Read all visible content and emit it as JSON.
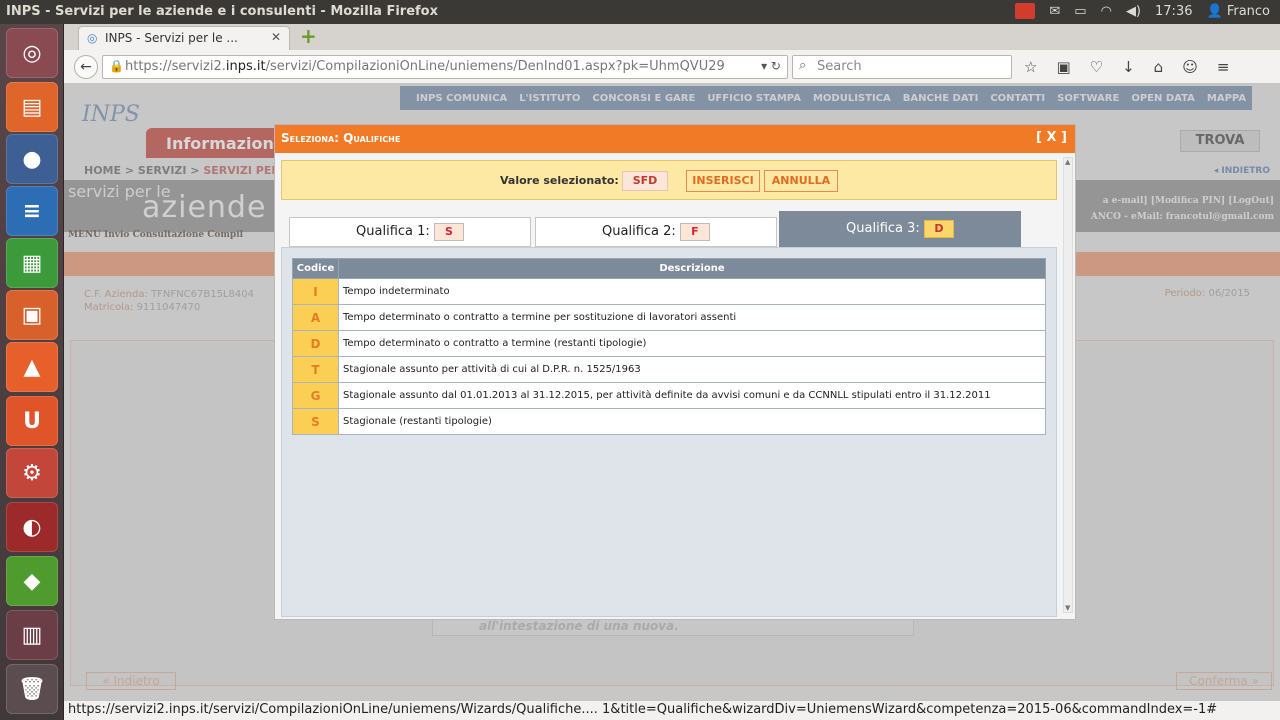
{
  "os": {
    "window_title": "INPS - Servizi per le aziende e i consulenti - Mozilla Firefox",
    "time": "17:36",
    "user": "Franco"
  },
  "browser": {
    "tab_title": "INPS - Servizi per le ...",
    "url_prefix": "https://servizi2.",
    "url_domain": "inps.it",
    "url_path": "/servizi/CompilazioniOnLine/uniemens/DenInd01.aspx?pk=UhmQVU29",
    "search_placeholder": "Search",
    "status_url": "https://servizi2.inps.it/servizi/CompilazioniOnLine/uniemens/Wizards/Qualifiche.... 1&title=Qualifiche&wizardDiv=UniemensWizard&competenza=2015-06&commandIndex=-1#"
  },
  "site": {
    "logo": "INPS",
    "top_menu": [
      "INPS COMUNICA",
      "L'ISTITUTO",
      "CONCORSI E GARE",
      "UFFICIO STAMPA",
      "MODULISTICA",
      "BANCHE DATI",
      "CONTATTI",
      "SOFTWARE",
      "OPEN DATA",
      "MAPPA"
    ],
    "info_tab": "Informazion",
    "trova": "TROVA",
    "breadcrumb_home": "HOME > SERVIZI > ",
    "breadcrumb_current": "SERVIZI PER L",
    "indietro_top": "INDIETRO",
    "az_small": "servizi per le",
    "az_big": "aziende",
    "az_links": "a e-mail]  [Modifica PIN]  [LogOut]",
    "az_links2": "ANCO - eMail: francotul@gmail.com",
    "menu_line": "MENU  Invio  Consultazione  Compil",
    "cf_label": "C.F. Azienda:",
    "cf_value": "TFNFNC67B15L8404",
    "matricola_label": "Matricola:",
    "matricola_value": "9111047470",
    "periodo_label": "Periodo:",
    "periodo_value": "06/2015",
    "intestazione": "all'intestazione di una nuova.",
    "btn_indietro": "« Indietro",
    "btn_conferma": "Conferma »"
  },
  "dialog": {
    "title": "Seleziona: Qualifiche",
    "close": "[ X ]",
    "selected_label": "Valore selezionato:",
    "selected_value": "SFD",
    "insert": "INSERISCI",
    "cancel": "ANNULLA",
    "tabs": [
      {
        "label": "Qualifica 1:",
        "value": "S"
      },
      {
        "label": "Qualifica 2:",
        "value": "F"
      },
      {
        "label": "Qualifica 3:",
        "value": "D"
      }
    ],
    "table": {
      "col_code": "Codice",
      "col_desc": "Descrizione",
      "rows": [
        {
          "code": "I",
          "desc": "Tempo indeterminato"
        },
        {
          "code": "A",
          "desc": "Tempo determinato o contratto a termine per sostituzione di lavoratori assenti"
        },
        {
          "code": "D",
          "desc": "Tempo determinato o contratto a termine (restanti tipologie)"
        },
        {
          "code": "T",
          "desc": "Stagionale assunto per attività di cui al D.P.R. n. 1525/1963"
        },
        {
          "code": "G",
          "desc": "Stagionale assunto dal 01.01.2013 al 31.12.2015, per attività definite da avvisi comuni e da CCNNLL stipulati entro il 31.12.2011"
        },
        {
          "code": "S",
          "desc": "Stagionale (restanti tipologie)"
        }
      ]
    }
  }
}
